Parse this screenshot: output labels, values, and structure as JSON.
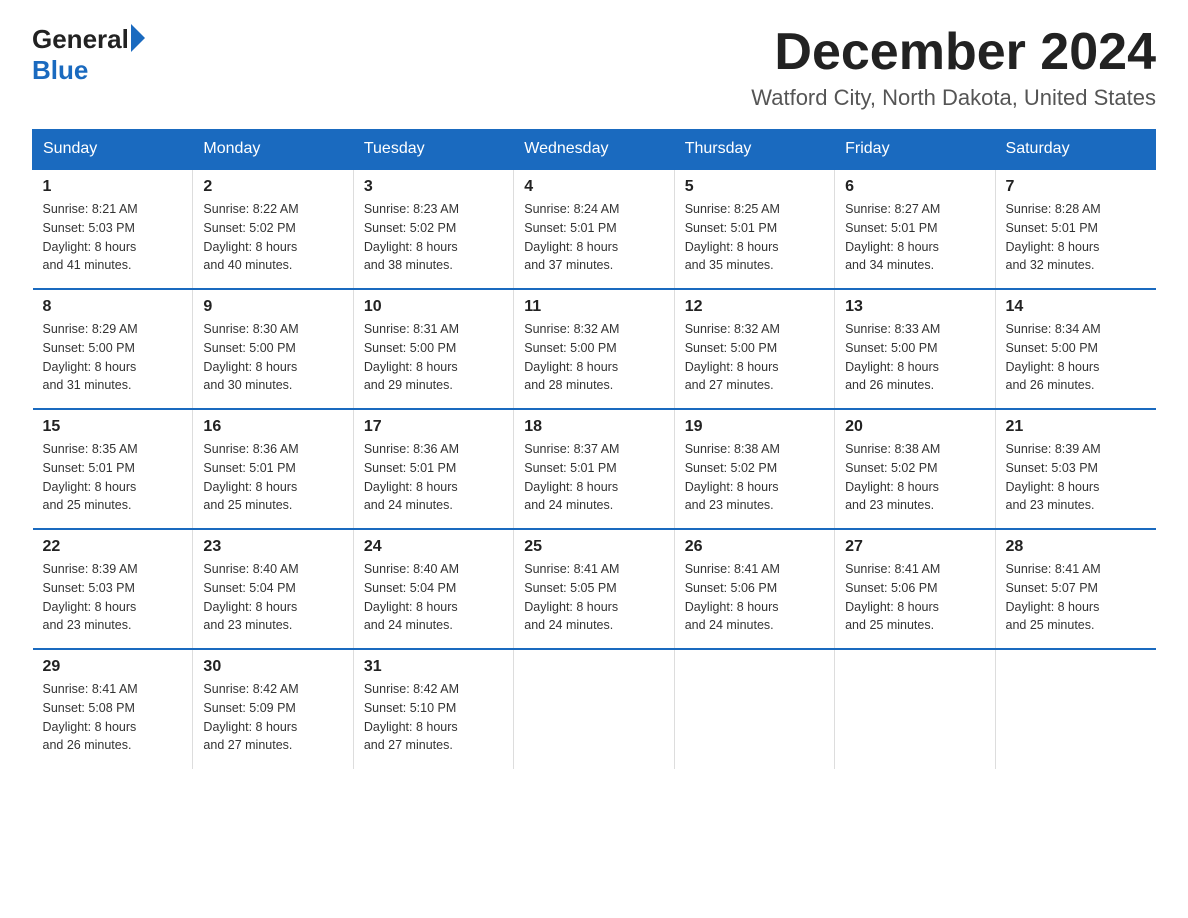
{
  "header": {
    "logo_general": "General",
    "logo_blue": "Blue",
    "month_title": "December 2024",
    "location": "Watford City, North Dakota, United States"
  },
  "weekdays": [
    "Sunday",
    "Monday",
    "Tuesday",
    "Wednesday",
    "Thursday",
    "Friday",
    "Saturday"
  ],
  "weeks": [
    [
      {
        "day": "1",
        "sunrise": "8:21 AM",
        "sunset": "5:03 PM",
        "daylight": "8 hours and 41 minutes."
      },
      {
        "day": "2",
        "sunrise": "8:22 AM",
        "sunset": "5:02 PM",
        "daylight": "8 hours and 40 minutes."
      },
      {
        "day": "3",
        "sunrise": "8:23 AM",
        "sunset": "5:02 PM",
        "daylight": "8 hours and 38 minutes."
      },
      {
        "day": "4",
        "sunrise": "8:24 AM",
        "sunset": "5:01 PM",
        "daylight": "8 hours and 37 minutes."
      },
      {
        "day": "5",
        "sunrise": "8:25 AM",
        "sunset": "5:01 PM",
        "daylight": "8 hours and 35 minutes."
      },
      {
        "day": "6",
        "sunrise": "8:27 AM",
        "sunset": "5:01 PM",
        "daylight": "8 hours and 34 minutes."
      },
      {
        "day": "7",
        "sunrise": "8:28 AM",
        "sunset": "5:01 PM",
        "daylight": "8 hours and 32 minutes."
      }
    ],
    [
      {
        "day": "8",
        "sunrise": "8:29 AM",
        "sunset": "5:00 PM",
        "daylight": "8 hours and 31 minutes."
      },
      {
        "day": "9",
        "sunrise": "8:30 AM",
        "sunset": "5:00 PM",
        "daylight": "8 hours and 30 minutes."
      },
      {
        "day": "10",
        "sunrise": "8:31 AM",
        "sunset": "5:00 PM",
        "daylight": "8 hours and 29 minutes."
      },
      {
        "day": "11",
        "sunrise": "8:32 AM",
        "sunset": "5:00 PM",
        "daylight": "8 hours and 28 minutes."
      },
      {
        "day": "12",
        "sunrise": "8:32 AM",
        "sunset": "5:00 PM",
        "daylight": "8 hours and 27 minutes."
      },
      {
        "day": "13",
        "sunrise": "8:33 AM",
        "sunset": "5:00 PM",
        "daylight": "8 hours and 26 minutes."
      },
      {
        "day": "14",
        "sunrise": "8:34 AM",
        "sunset": "5:00 PM",
        "daylight": "8 hours and 26 minutes."
      }
    ],
    [
      {
        "day": "15",
        "sunrise": "8:35 AM",
        "sunset": "5:01 PM",
        "daylight": "8 hours and 25 minutes."
      },
      {
        "day": "16",
        "sunrise": "8:36 AM",
        "sunset": "5:01 PM",
        "daylight": "8 hours and 25 minutes."
      },
      {
        "day": "17",
        "sunrise": "8:36 AM",
        "sunset": "5:01 PM",
        "daylight": "8 hours and 24 minutes."
      },
      {
        "day": "18",
        "sunrise": "8:37 AM",
        "sunset": "5:01 PM",
        "daylight": "8 hours and 24 minutes."
      },
      {
        "day": "19",
        "sunrise": "8:38 AM",
        "sunset": "5:02 PM",
        "daylight": "8 hours and 23 minutes."
      },
      {
        "day": "20",
        "sunrise": "8:38 AM",
        "sunset": "5:02 PM",
        "daylight": "8 hours and 23 minutes."
      },
      {
        "day": "21",
        "sunrise": "8:39 AM",
        "sunset": "5:03 PM",
        "daylight": "8 hours and 23 minutes."
      }
    ],
    [
      {
        "day": "22",
        "sunrise": "8:39 AM",
        "sunset": "5:03 PM",
        "daylight": "8 hours and 23 minutes."
      },
      {
        "day": "23",
        "sunrise": "8:40 AM",
        "sunset": "5:04 PM",
        "daylight": "8 hours and 23 minutes."
      },
      {
        "day": "24",
        "sunrise": "8:40 AM",
        "sunset": "5:04 PM",
        "daylight": "8 hours and 24 minutes."
      },
      {
        "day": "25",
        "sunrise": "8:41 AM",
        "sunset": "5:05 PM",
        "daylight": "8 hours and 24 minutes."
      },
      {
        "day": "26",
        "sunrise": "8:41 AM",
        "sunset": "5:06 PM",
        "daylight": "8 hours and 24 minutes."
      },
      {
        "day": "27",
        "sunrise": "8:41 AM",
        "sunset": "5:06 PM",
        "daylight": "8 hours and 25 minutes."
      },
      {
        "day": "28",
        "sunrise": "8:41 AM",
        "sunset": "5:07 PM",
        "daylight": "8 hours and 25 minutes."
      }
    ],
    [
      {
        "day": "29",
        "sunrise": "8:41 AM",
        "sunset": "5:08 PM",
        "daylight": "8 hours and 26 minutes."
      },
      {
        "day": "30",
        "sunrise": "8:42 AM",
        "sunset": "5:09 PM",
        "daylight": "8 hours and 27 minutes."
      },
      {
        "day": "31",
        "sunrise": "8:42 AM",
        "sunset": "5:10 PM",
        "daylight": "8 hours and 27 minutes."
      },
      null,
      null,
      null,
      null
    ]
  ],
  "labels": {
    "sunrise": "Sunrise:",
    "sunset": "Sunset:",
    "daylight": "Daylight:"
  }
}
